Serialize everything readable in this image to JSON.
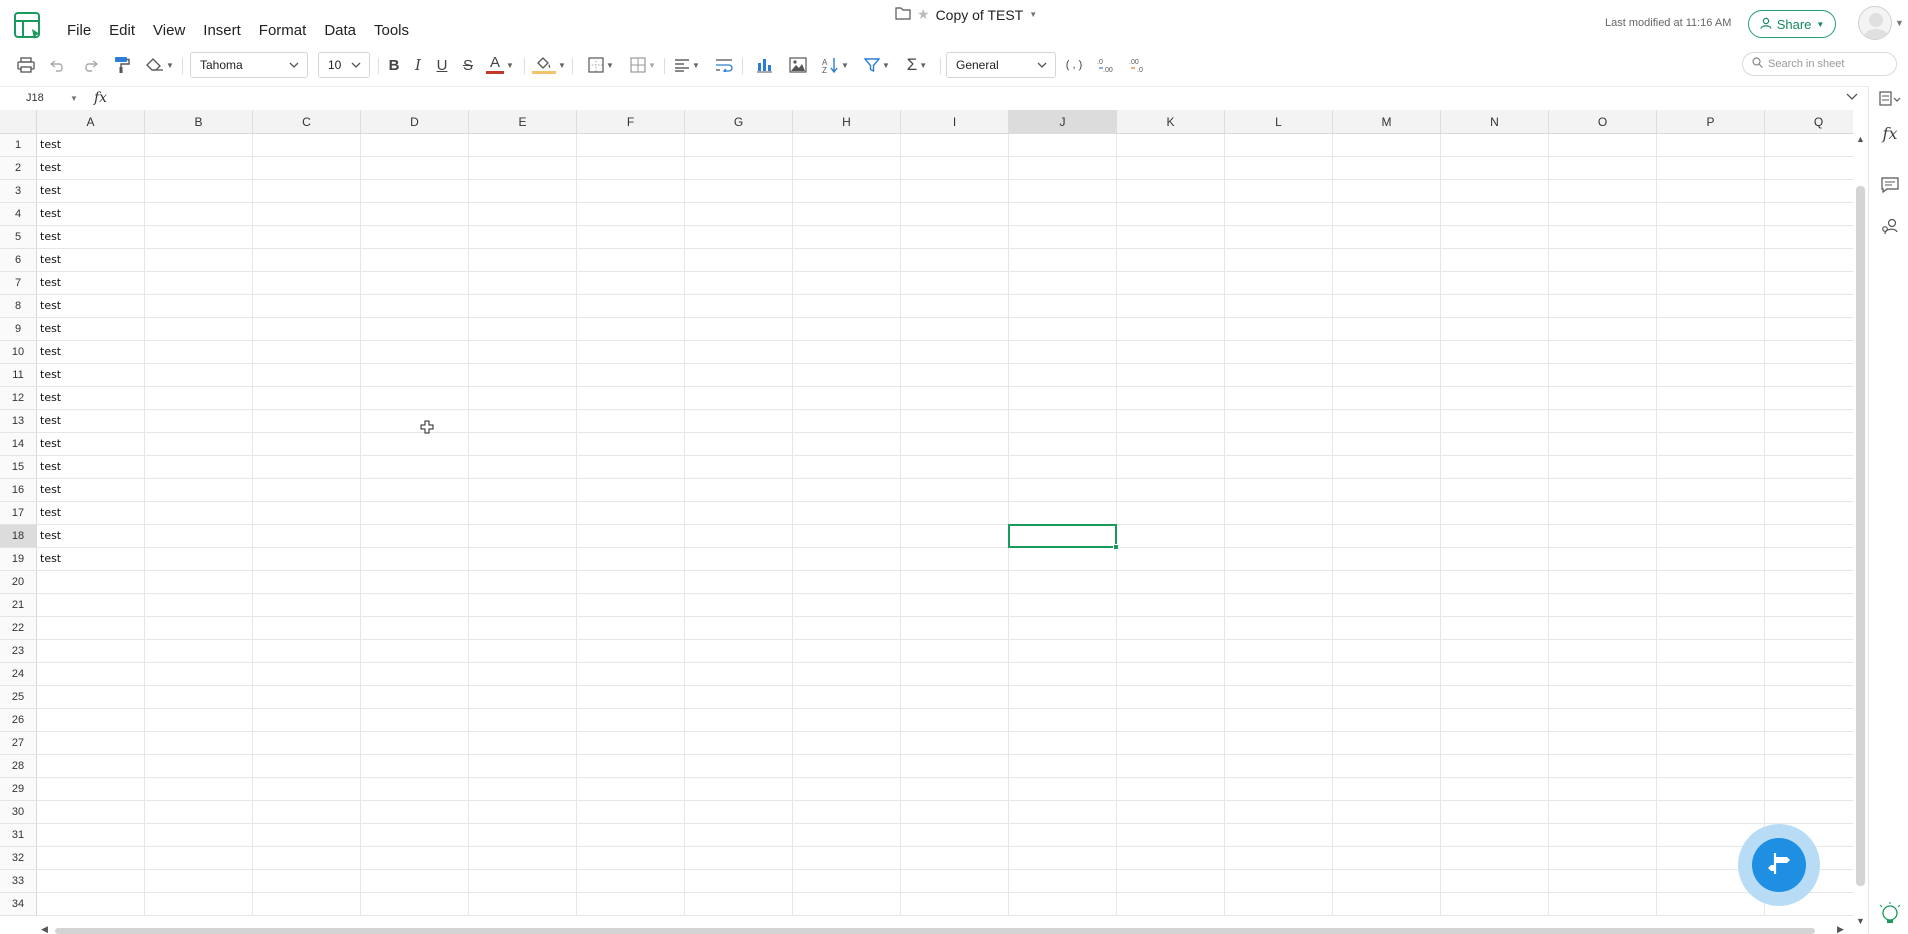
{
  "menu": [
    "File",
    "Edit",
    "View",
    "Insert",
    "Format",
    "Data",
    "Tools"
  ],
  "document": {
    "title": "Copy of TEST",
    "last_modified": "Last modified at 11:16 AM"
  },
  "share": {
    "label": "Share"
  },
  "toolbar": {
    "font_family": "Tahoma",
    "font_size": "10",
    "number_format": "General",
    "bold": "B",
    "italic": "I",
    "underline": "U",
    "strikethrough": "S",
    "font_color": "A"
  },
  "search": {
    "placeholder": "Search in sheet"
  },
  "formula_bar": {
    "cell_reference": "J18",
    "fx": "fx",
    "value": ""
  },
  "grid": {
    "columns": [
      "A",
      "B",
      "C",
      "D",
      "E",
      "F",
      "G",
      "H",
      "I",
      "J",
      "K",
      "L",
      "M",
      "N",
      "O",
      "P",
      "Q"
    ],
    "selected_column": "J",
    "selected_row": 18,
    "row_count": 34,
    "cells_A": [
      "test",
      "test",
      "test",
      "test",
      "test",
      "test",
      "test",
      "test",
      "test",
      "test",
      "test",
      "test",
      "test",
      "test",
      "test",
      "test",
      "test",
      "test",
      "test"
    ]
  },
  "colors": {
    "accent": "#1a9a5c",
    "fab": "#1e8fe3",
    "font_color_bar": "#c0392b",
    "fill_color_bar": "#f5c26b"
  }
}
